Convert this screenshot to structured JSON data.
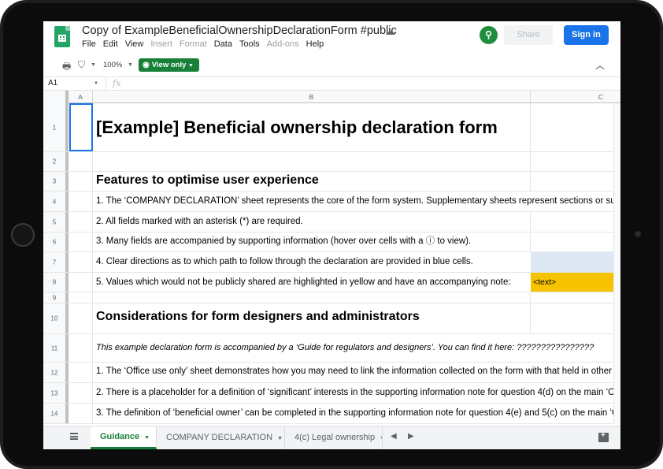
{
  "app": {
    "title": "Copy of ExampleBeneficialOwnershipDeclarationForm #public",
    "menu": [
      "File",
      "Edit",
      "View",
      "Insert",
      "Format",
      "Data",
      "Tools",
      "Add-ons",
      "Help"
    ],
    "menu_disabled": [
      "Insert",
      "Format",
      "Add-ons"
    ],
    "share_label": "Share",
    "signin_label": "Sign in"
  },
  "toolbar": {
    "zoom": "100%",
    "view_only_label": "View only"
  },
  "formula_bar": {
    "cell_ref": "A1",
    "fx_label": "fx",
    "value": ""
  },
  "columns": [
    "A",
    "B",
    "C"
  ],
  "rows": [
    {
      "num": "1",
      "style": "heading1",
      "text": "[Example] Beneficial ownership declaration form"
    },
    {
      "num": "2",
      "style": "body",
      "text": ""
    },
    {
      "num": "3",
      "style": "heading2",
      "text": "Features to optimise user experience"
    },
    {
      "num": "4",
      "style": "body",
      "text": "1. The ‘COMPANY DECLARATION’ sheet represents the core of the form system. Supplementary sheets represent sections or su"
    },
    {
      "num": "5",
      "style": "body",
      "text": "2. All fields marked with an asterisk (*) are required."
    },
    {
      "num": "6",
      "style": "body",
      "text": "3. Many fields are accompanied by supporting information (hover over cells with a ⓘ to view)."
    },
    {
      "num": "7",
      "style": "body",
      "text": "4. Clear directions as to which path to follow through the declaration are provided in blue cells."
    },
    {
      "num": "8",
      "style": "body",
      "text": "5. Values which would not be publicly shared are highlighted in yellow and have an accompanying note:",
      "c_text": "<text>"
    },
    {
      "num": "9",
      "style": "body",
      "text": ""
    },
    {
      "num": "10",
      "style": "heading2",
      "text": "Considerations for form designers and administrators"
    },
    {
      "num": "11",
      "style": "italic",
      "text": "This example declaration form is accompanied by a ‘Guide for regulators and designers’.  You can find it here: ????????????????"
    },
    {
      "num": "12",
      "style": "body",
      "text": "1. The ‘Office use only’ sheet demonstrates how you may need to link the information collected on the form with that held in other"
    },
    {
      "num": "13",
      "style": "body",
      "text": "2. There is a placeholder for a definition of ‘significant’ interests in the supporting information note for question 4(d) on the main ‘C"
    },
    {
      "num": "14",
      "style": "body",
      "text": "3. The definition of ‘beneficial owner’ can be completed in the supporting information note for question 4(e) and 5(c) on the main ‘C"
    }
  ],
  "sheet_tabs": [
    {
      "label": "Guidance",
      "active": true
    },
    {
      "label": "COMPANY DECLARATION",
      "active": false
    },
    {
      "label": "4(c) Legal ownership",
      "active": false
    }
  ],
  "colors": {
    "brand_green": "#188038",
    "signin_blue": "#1a73e8",
    "info_blue_cell": "#dde8f4",
    "private_yellow_cell": "#f6c300"
  },
  "icons": {
    "logo": "google-sheets-logo-icon",
    "cloud": "cloud-saved-icon",
    "print": "print-icon",
    "filter": "filter-icon",
    "view_only": "eye-icon",
    "collapse": "chevron-up-icon",
    "all_sheets": "hamburger-menu-icon",
    "explore": "explore-icon"
  }
}
